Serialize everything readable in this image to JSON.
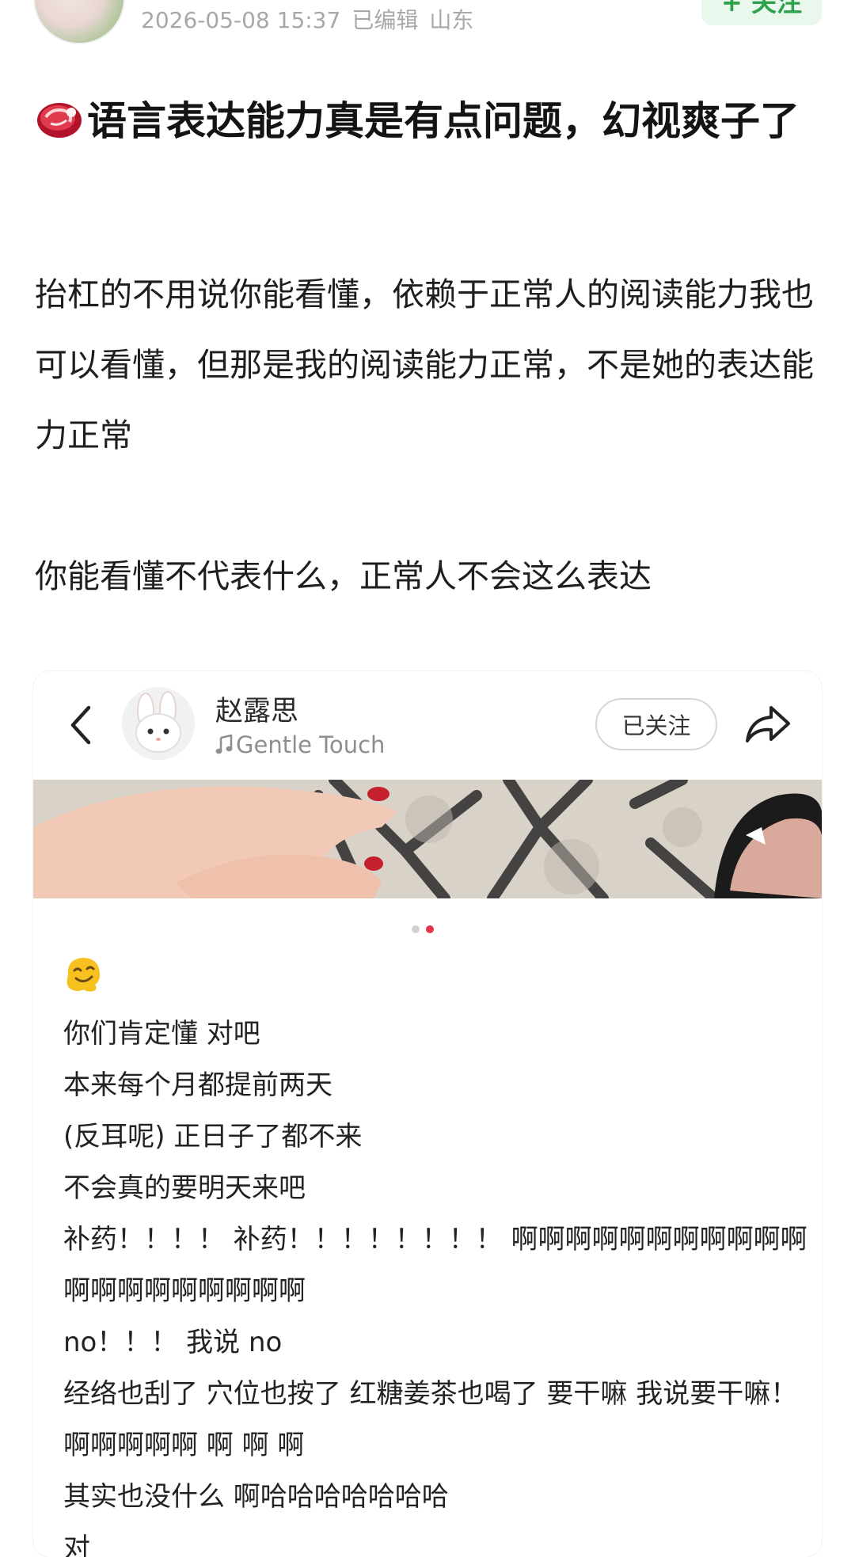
{
  "meta": {
    "timestamp": "2026-05-08 15:37",
    "edited": "已编辑",
    "location": "山东",
    "follow_label": "+ 关注"
  },
  "title": "语言表达能力真是有点问题，幻视爽子了",
  "body": {
    "p1": "抬杠的不用说你能看懂，依赖于正常人的阅读能力我也可以看懂，但那是我的阅读能力正常，不是她的表达能力正常",
    "p2": "你能看懂不代表什么，正常人不会这么表达"
  },
  "card": {
    "user_name": "赵露思",
    "music": "Gentle Touch",
    "followed_label": "已关注",
    "lines": [
      "你们肯定懂 对吧",
      "本来每个月都提前两天",
      "(反耳呢) 正日子了都不来",
      "不会真的要明天来吧",
      "补药！！！！ 补药！！！！！！！！ 啊啊啊啊啊啊啊啊啊啊啊啊啊啊啊啊啊啊啊啊",
      "no！！！ 我说 no",
      "经络也刮了 穴位也按了 红糖姜茶也喝了 要干嘛 我说要干嘛！ 啊啊啊啊啊 啊 啊 啊",
      "其实也没什么 啊哈哈哈哈哈哈哈",
      "对"
    ]
  },
  "colors": {
    "accent_green": "#2da14b",
    "meta_gray": "#a8a8a8",
    "dot_active": "#e8334a"
  },
  "icons": [
    "meat-emoji-icon",
    "back-arrow-icon",
    "music-note-icon",
    "share-icon",
    "melting-face-emoji-icon"
  ]
}
